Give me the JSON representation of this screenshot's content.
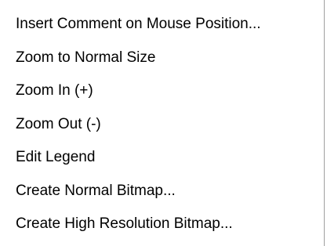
{
  "context_menu": {
    "items": [
      {
        "label": "Insert Comment on Mouse Position..."
      },
      {
        "label": "Zoom to Normal Size"
      },
      {
        "label": "Zoom In (+)"
      },
      {
        "label": "Zoom Out (-)"
      },
      {
        "label": "Edit Legend"
      },
      {
        "label": "Create Normal Bitmap..."
      },
      {
        "label": "Create High Resolution Bitmap..."
      }
    ]
  }
}
